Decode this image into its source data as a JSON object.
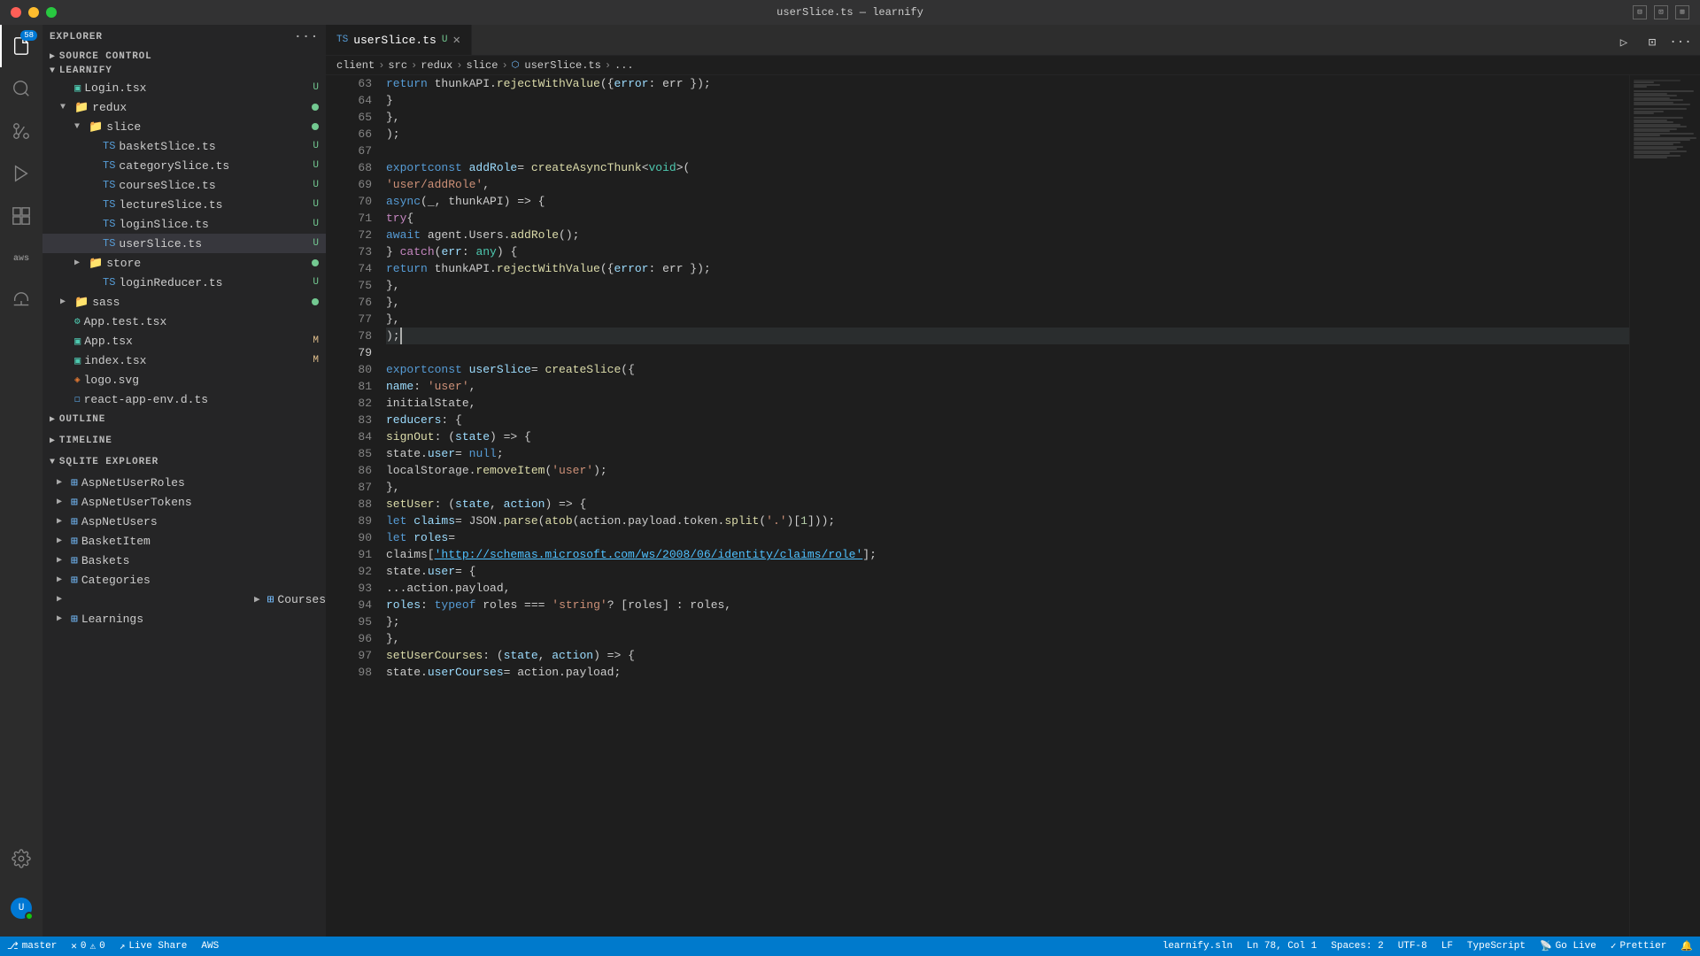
{
  "titleBar": {
    "title": "userSlice.ts — learnify",
    "trafficLights": [
      "red",
      "yellow",
      "green"
    ]
  },
  "activityBar": {
    "icons": [
      {
        "name": "files-icon",
        "symbol": "⬚",
        "active": true,
        "badge": "58"
      },
      {
        "name": "search-icon",
        "symbol": "🔍",
        "active": false
      },
      {
        "name": "source-control-icon",
        "symbol": "⎇",
        "active": false
      },
      {
        "name": "run-icon",
        "symbol": "▷",
        "active": false
      },
      {
        "name": "extensions-icon",
        "symbol": "⊞",
        "active": false
      },
      {
        "name": "remote-icon",
        "symbol": "aws",
        "active": false
      },
      {
        "name": "liveshare-icon",
        "symbol": "↗",
        "active": false
      },
      {
        "name": "settings-icon",
        "symbol": "⚙",
        "active": false
      }
    ]
  },
  "sidebar": {
    "explorerHeader": "EXPLORER",
    "dotsLabel": "···",
    "learnifyLabel": "LEARNIFY",
    "sourceControlLabel": "SOURCE CONTROL",
    "tree": [
      {
        "level": 0,
        "type": "folder",
        "name": "Login.tsx",
        "icon": "tsx",
        "badge": "U",
        "badgeType": "u",
        "indent": 16
      },
      {
        "level": 1,
        "type": "folder",
        "name": "redux",
        "icon": "folder",
        "indent": 16,
        "expanded": true,
        "dotColor": "green"
      },
      {
        "level": 2,
        "type": "folder",
        "name": "slice",
        "icon": "folder",
        "indent": 32,
        "expanded": true,
        "dotColor": "green"
      },
      {
        "level": 3,
        "type": "file",
        "name": "basketSlice.ts",
        "icon": "ts",
        "badge": "U",
        "badgeType": "u",
        "indent": 48
      },
      {
        "level": 3,
        "type": "file",
        "name": "categorySlice.ts",
        "icon": "ts",
        "badge": "U",
        "badgeType": "u",
        "indent": 48
      },
      {
        "level": 3,
        "type": "file",
        "name": "courseSlice.ts",
        "icon": "ts",
        "badge": "U",
        "badgeType": "u",
        "indent": 48
      },
      {
        "level": 3,
        "type": "file",
        "name": "lectureSlice.ts",
        "icon": "ts",
        "badge": "U",
        "badgeType": "u",
        "indent": 48
      },
      {
        "level": 3,
        "type": "file",
        "name": "loginSlice.ts",
        "icon": "ts",
        "badge": "U",
        "badgeType": "u",
        "indent": 48
      },
      {
        "level": 3,
        "type": "file",
        "name": "userSlice.ts",
        "icon": "ts",
        "badge": "U",
        "badgeType": "u",
        "indent": 48,
        "active": true
      },
      {
        "level": 2,
        "type": "folder",
        "name": "store",
        "icon": "folder",
        "indent": 32,
        "dotColor": "green"
      },
      {
        "level": 3,
        "type": "file",
        "name": "loginReducer.ts",
        "icon": "ts",
        "badge": "U",
        "badgeType": "u",
        "indent": 48
      },
      {
        "level": 1,
        "type": "folder",
        "name": "sass",
        "icon": "folder-sass",
        "indent": 16,
        "dotColor": "green"
      },
      {
        "level": 0,
        "type": "file",
        "name": "App.test.tsx",
        "icon": "test-tsx",
        "indent": 16
      },
      {
        "level": 0,
        "type": "file",
        "name": "App.tsx",
        "icon": "tsx",
        "badge": "M",
        "badgeType": "m",
        "indent": 16
      },
      {
        "level": 0,
        "type": "file",
        "name": "index.tsx",
        "icon": "tsx",
        "badge": "M",
        "badgeType": "m",
        "indent": 16
      },
      {
        "level": 0,
        "type": "file",
        "name": "logo.svg",
        "icon": "svg",
        "indent": 16
      },
      {
        "level": 0,
        "type": "file",
        "name": "react-app-env.d.ts",
        "icon": "dts",
        "indent": 16
      }
    ],
    "outlineLabel": "OUTLINE",
    "timelineLabel": "TIMELINE",
    "sqliteLabel": "SQLITE EXPLORER",
    "sqliteTables": [
      "AspNetUserRoles",
      "AspNetUserTokens",
      "AspNetUsers",
      "BasketItem",
      "Baskets",
      "Categories",
      "Courses",
      "Learnings"
    ]
  },
  "tabs": [
    {
      "name": "userSlice.ts",
      "modified": true,
      "active": true
    }
  ],
  "breadcrumb": {
    "items": [
      "client",
      "src",
      "redux",
      "slice",
      "userSlice.ts",
      "..."
    ]
  },
  "code": {
    "startLine": 63,
    "lines": [
      {
        "n": 63,
        "text": "            return thunkAPI.rejectWithValue({ error: err });"
      },
      {
        "n": 64,
        "text": "        }"
      },
      {
        "n": 65,
        "text": "    },"
      },
      {
        "n": 66,
        "text": ");"
      },
      {
        "n": 67,
        "text": ""
      },
      {
        "n": 68,
        "text": "export const addRole = createAsyncThunk<void>("
      },
      {
        "n": 69,
        "text": "    'user/addRole',"
      },
      {
        "n": 70,
        "text": "    async (_, thunkAPI) => {"
      },
      {
        "n": 71,
        "text": "        try {"
      },
      {
        "n": 72,
        "text": "            await agent.Users.addRole();"
      },
      {
        "n": 73,
        "text": "        } catch (err: any) {"
      },
      {
        "n": 74,
        "text": "            return thunkAPI.rejectWithValue({ error: err });"
      },
      {
        "n": 75,
        "text": "        },"
      },
      {
        "n": 76,
        "text": "    },"
      },
      {
        "n": 77,
        "text": "},"
      },
      {
        "n": 78,
        "text": ");"
      },
      {
        "n": 79,
        "text": ""
      },
      {
        "n": 80,
        "text": "export const userSlice = createSlice({"
      },
      {
        "n": 81,
        "text": "    name: 'user',"
      },
      {
        "n": 82,
        "text": "    initialState,"
      },
      {
        "n": 83,
        "text": "    reducers: {"
      },
      {
        "n": 84,
        "text": "        signOut: (state) => {"
      },
      {
        "n": 85,
        "text": "            state.user = null;"
      },
      {
        "n": 86,
        "text": "            localStorage.removeItem('user');"
      },
      {
        "n": 87,
        "text": "        },"
      },
      {
        "n": 88,
        "text": "        setUser: (state, action) => {"
      },
      {
        "n": 89,
        "text": "            let claims = JSON.parse(atob(action.payload.token.split('.')[1]));"
      },
      {
        "n": 90,
        "text": "            let roles ="
      },
      {
        "n": 91,
        "text": "                claims['http://schemas.microsoft.com/ws/2008/06/identity/claims/role'];"
      },
      {
        "n": 92,
        "text": "            state.user = {"
      },
      {
        "n": 93,
        "text": "                ...action.payload,"
      },
      {
        "n": 94,
        "text": "                roles: typeof roles === 'string' ? [roles] : roles,"
      },
      {
        "n": 95,
        "text": "            };"
      },
      {
        "n": 96,
        "text": "        },"
      },
      {
        "n": 97,
        "text": "        setUserCourses: (state, action) => {"
      },
      {
        "n": 98,
        "text": "            state.userCourses = action.payload;"
      }
    ]
  },
  "statusBar": {
    "branch": "master",
    "errors": "0",
    "warnings": "0",
    "liveShare": "Live Share",
    "aws": "AWS",
    "projectName": "learnify.sln",
    "line": "Ln 78",
    "col": "Col 1",
    "spaces": "Spaces: 2",
    "encoding": "UTF-8",
    "eol": "LF",
    "language": "TypeScript",
    "goLive": "Go Live",
    "prettier": "Prettier"
  }
}
